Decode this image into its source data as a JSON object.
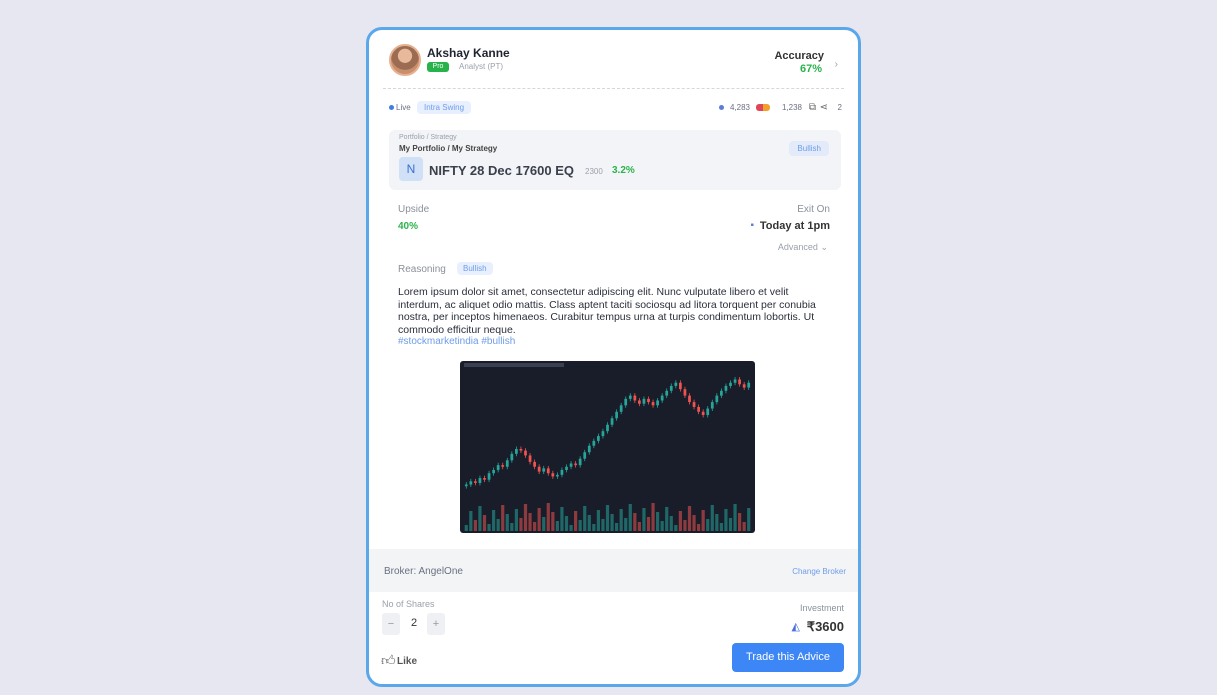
{
  "user": {
    "name": "Akshay Kanne",
    "badge": "Pro",
    "subtitle": "Analyst (PT)"
  },
  "accuracy": {
    "label": "Accuracy",
    "value": "67%"
  },
  "meta": {
    "live_label": "Live",
    "tag": "Intra Swing",
    "stat1": "4,283",
    "stat2": "1,238",
    "share_count": "2"
  },
  "trade": {
    "label": "Portfolio / Strategy",
    "path": "My Portfolio / My Strategy",
    "icon_glyph": "N",
    "instrument": "NIFTY 28 Dec 17600 EQ",
    "price": "2300",
    "change": "3.2%",
    "button": "Bullish"
  },
  "upside": {
    "label": "Upside",
    "value": "40%"
  },
  "exit": {
    "label": "Exit On",
    "value": "Today at 1pm"
  },
  "advanced_label": "Advanced",
  "reasoning": {
    "label": "Reasoning",
    "tag": "Bullish",
    "text": "Lorem ipsum dolor sit amet, consectetur adipiscing elit. Nunc vulputate libero et velit interdum, ac aliquet odio mattis. Class aptent taciti sociosqu ad litora torquent per conubia nostra, per inceptos himenaeos. Curabitur tempus urna at turpis condimentum lobortis. Ut commodo efficitur neque.",
    "hashtags": "#stockmarketindia #bullish"
  },
  "broker": {
    "label": "Broker: AngelOne",
    "change_label": "Change Broker"
  },
  "shares": {
    "label": "No of Shares",
    "value": "2",
    "minus": "−",
    "plus": "+"
  },
  "investment": {
    "label": "Investment",
    "value": "₹3600"
  },
  "like_label": "Like",
  "trade_button_label": "Trade this Advice",
  "colors": {
    "accent": "#3d86f5",
    "positive": "#2bb24c",
    "border": "#5aa7ea",
    "chart_bg": "#191d2a",
    "candle_up": "#26a69a",
    "candle_down": "#ef5350"
  },
  "chart_image": {
    "icon": "candlestick-chart-image",
    "closes": [
      33,
      35,
      34,
      37,
      36,
      40,
      42,
      45,
      44,
      48,
      52,
      55,
      54,
      51,
      47,
      44,
      41,
      43,
      40,
      38,
      39,
      42,
      44,
      46,
      45,
      49,
      53,
      57,
      60,
      63,
      66,
      70,
      74,
      78,
      82,
      86,
      88,
      85,
      83,
      86,
      84,
      82,
      85,
      88,
      91,
      94,
      96,
      92,
      88,
      84,
      81,
      78,
      76,
      80,
      84,
      88,
      91,
      94,
      96,
      98,
      95,
      93,
      96
    ]
  }
}
